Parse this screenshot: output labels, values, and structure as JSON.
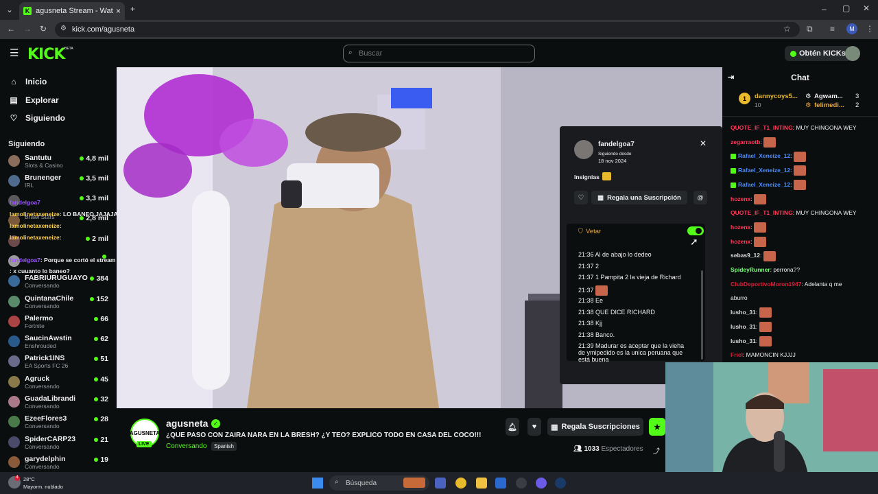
{
  "browser": {
    "tab_title": "agusneta Stream - Watch Live o",
    "url": "kick.com/agusneta",
    "profile_initial": "M"
  },
  "header": {
    "logo": "KICK",
    "logo_beta": "BETA",
    "search_placeholder": "Buscar",
    "get_kicks": "Obtén KICKs"
  },
  "sidebar": {
    "nav": [
      {
        "label": "Inicio"
      },
      {
        "label": "Explorar"
      },
      {
        "label": "Siguiendo"
      }
    ],
    "following_header": "Siguiendo",
    "channels": [
      {
        "name": "Santutu",
        "category": "Slots & Casino",
        "viewers": "4,8 mil",
        "color": "#8a6d5a"
      },
      {
        "name": "Brunenger",
        "category": "IRL",
        "viewers": "3,5 mil",
        "color": "#4e6a8c"
      },
      {
        "name": "",
        "category": "",
        "viewers": "3,3 mil",
        "color": "#5a5a5a"
      },
      {
        "name": "",
        "category": "Brawl Stars",
        "viewers": "2,8 mil",
        "color": "#7a5a3a"
      },
      {
        "name": "",
        "category": "",
        "viewers": "2 mil",
        "color": "#6a4a4a"
      },
      {
        "name": "",
        "category": "",
        "viewers": "",
        "color": "#9a9a9a"
      },
      {
        "name": "FABRIURUGUAYO",
        "category": "Conversando",
        "viewers": "384",
        "color": "#3a6a9a"
      },
      {
        "name": "QuintanaChile",
        "category": "Conversando",
        "viewers": "152",
        "color": "#5a8a6a"
      },
      {
        "name": "Palermo",
        "category": "Fortnite",
        "viewers": "66",
        "color": "#aa4444"
      },
      {
        "name": "SaucinAwstin",
        "category": "Enshrouded",
        "viewers": "62",
        "color": "#2a5a8a"
      },
      {
        "name": "Patrick1INS",
        "category": "EA Sports FC 26",
        "viewers": "51",
        "color": "#6a6a8a"
      },
      {
        "name": "Agruck",
        "category": "Conversando",
        "viewers": "45",
        "color": "#8a7a4a"
      },
      {
        "name": "GuadaLibrandi",
        "category": "Conversando",
        "viewers": "32",
        "color": "#aa7a8a"
      },
      {
        "name": "EzeeFlores3",
        "category": "Conversando",
        "viewers": "28",
        "color": "#4a7a4a"
      },
      {
        "name": "SpiderCARP23",
        "category": "Conversando",
        "viewers": "21",
        "color": "#4a4a6a"
      },
      {
        "name": "garydelphin",
        "category": "Conversando",
        "viewers": "19",
        "color": "#8a5a3a"
      }
    ],
    "overlay_msgs": [
      {
        "user": "fandelgoa7",
        "text": "",
        "color": "#9b59ff"
      },
      {
        "user": "lamolinetaxeneize",
        "text": ": LO BANEO JAJAJA",
        "color": "#ffd24a"
      },
      {
        "user": "lamolinetaxeneize",
        "text": ":",
        "color": "#ffd24a"
      },
      {
        "user": "lamolinetaxeneize",
        "text": ":",
        "color": "#ffd24a"
      },
      {
        "user": "fandelgoa7",
        "text": ": Porque se cortó el stream",
        "color": "#9b59ff"
      },
      {
        "user": "",
        "text": ": x cuuanto lo baneo?",
        "color": "#9b59ff"
      }
    ]
  },
  "stream": {
    "channel": "agusneta",
    "title": "¿QUE PASO CON ZAIRA NARA EN LA BRESH? ¿Y TEO? EXPLICO TODO EN CASA DEL COCO!!!",
    "category": "Conversando",
    "language": "Spanish",
    "live": "LIVE",
    "avatar_text": "AGUSNETA",
    "gift_button": "Regala Suscripciones",
    "viewer_count": "1033",
    "viewer_label": "Espectadores"
  },
  "chat": {
    "title": "Chat",
    "pinned": [
      {
        "user": "dannycoys5...",
        "count": "10"
      },
      {
        "user": "Agwam...",
        "count": "3"
      },
      {
        "user": "felimedi...",
        "count": "2"
      }
    ],
    "rank": "1",
    "messages": [
      {
        "user": "QUOTE_IF_T1_INTING",
        "text": ": MUY CHINGONA WEY",
        "color": "#ff3a5a",
        "emote": false,
        "badge": false
      },
      {
        "user": "zegarraotb",
        "text": ":",
        "color": "#ff3a5a",
        "emote": true,
        "badge": false
      },
      {
        "user": "Rafael_Xeneize_12",
        "text": ":",
        "color": "#4a8cff",
        "emote": true,
        "badge": true
      },
      {
        "user": "Rafael_Xeneize_12",
        "text": ":",
        "color": "#4a8cff",
        "emote": true,
        "badge": true
      },
      {
        "user": "Rafael_Xeneize_12",
        "text": ":",
        "color": "#4a8cff",
        "emote": true,
        "badge": true
      },
      {
        "user": "hozenx",
        "text": ":",
        "color": "#ff3a5a",
        "emote": true,
        "badge": false
      },
      {
        "user": "QUOTE_IF_T1_INTING",
        "text": ": MUY CHINGONA WEY",
        "color": "#ff3a5a",
        "emote": false,
        "badge": false
      },
      {
        "user": "hozenx",
        "text": ":",
        "color": "#ff3a5a",
        "emote": true,
        "badge": false
      },
      {
        "user": "hozenx",
        "text": ":",
        "color": "#ff3a5a",
        "emote": true,
        "badge": false
      },
      {
        "user": "sebas9_12",
        "text": ":",
        "color": "#dddddd",
        "emote": true,
        "badge": false
      },
      {
        "user": "SpideyRunner",
        "text": ": perrona??",
        "color": "#7aff7a",
        "emote": false,
        "badge": false
      },
      {
        "user": "ClubDeportivoMoron1947",
        "text": ": Adelanta q me",
        "color": "#d8203a",
        "emote": false,
        "badge": false
      },
      {
        "user": "",
        "text": "aburro",
        "color": "#dddddd",
        "emote": false,
        "badge": false
      },
      {
        "user": "lusho_31",
        "text": ":",
        "color": "#dddddd",
        "emote": true,
        "badge": false
      },
      {
        "user": "lusho_31",
        "text": ":",
        "color": "#dddddd",
        "emote": true,
        "badge": false
      },
      {
        "user": "lusho_31",
        "text": ":",
        "color": "#dddddd",
        "emote": true,
        "badge": false
      },
      {
        "user": "Friel",
        "text": ": MAMONCIN KJJJJ",
        "color": "#d8203a",
        "emote": false,
        "badge": false
      }
    ]
  },
  "popup": {
    "username": "fandelgoa7",
    "following_since_label": "Siguiendo desde",
    "following_since_date": "18 nov 2024",
    "badges_label": "Insignias",
    "gift_sub": "Regala una Suscripción",
    "veto_label": "Vetar",
    "veto_on": true,
    "history": [
      {
        "time": "21:36",
        "text": "Al de abajo lo dedeo",
        "emote": false
      },
      {
        "time": "21:37",
        "text": "2",
        "emote": false
      },
      {
        "time": "21:37",
        "text": "1 Pampita 2 la vieja de Richard",
        "emote": false
      },
      {
        "time": "21:37",
        "text": "",
        "emote": true
      },
      {
        "time": "21:38",
        "text": "Ee",
        "emote": false
      },
      {
        "time": "21:38",
        "text": "QUE DICE RICHARD",
        "emote": false
      },
      {
        "time": "21:38",
        "text": "Kjj",
        "emote": false
      },
      {
        "time": "21:38",
        "text": "Banco.",
        "emote": false
      }
    ],
    "last_time": "21:39",
    "last_lines": [
      "Madurar es aceptar que la vieha",
      "de ymipedido es la unica peruana que",
      "está buena"
    ]
  },
  "weather": {
    "temp": "28°C",
    "desc": "Mayorm. nublado",
    "alerts": "4"
  },
  "taskbar": {
    "search": "Búsqueda"
  },
  "colors": {
    "accent": "#53fc18",
    "bg": "#0b0e0f",
    "panel": "#191b1f"
  }
}
